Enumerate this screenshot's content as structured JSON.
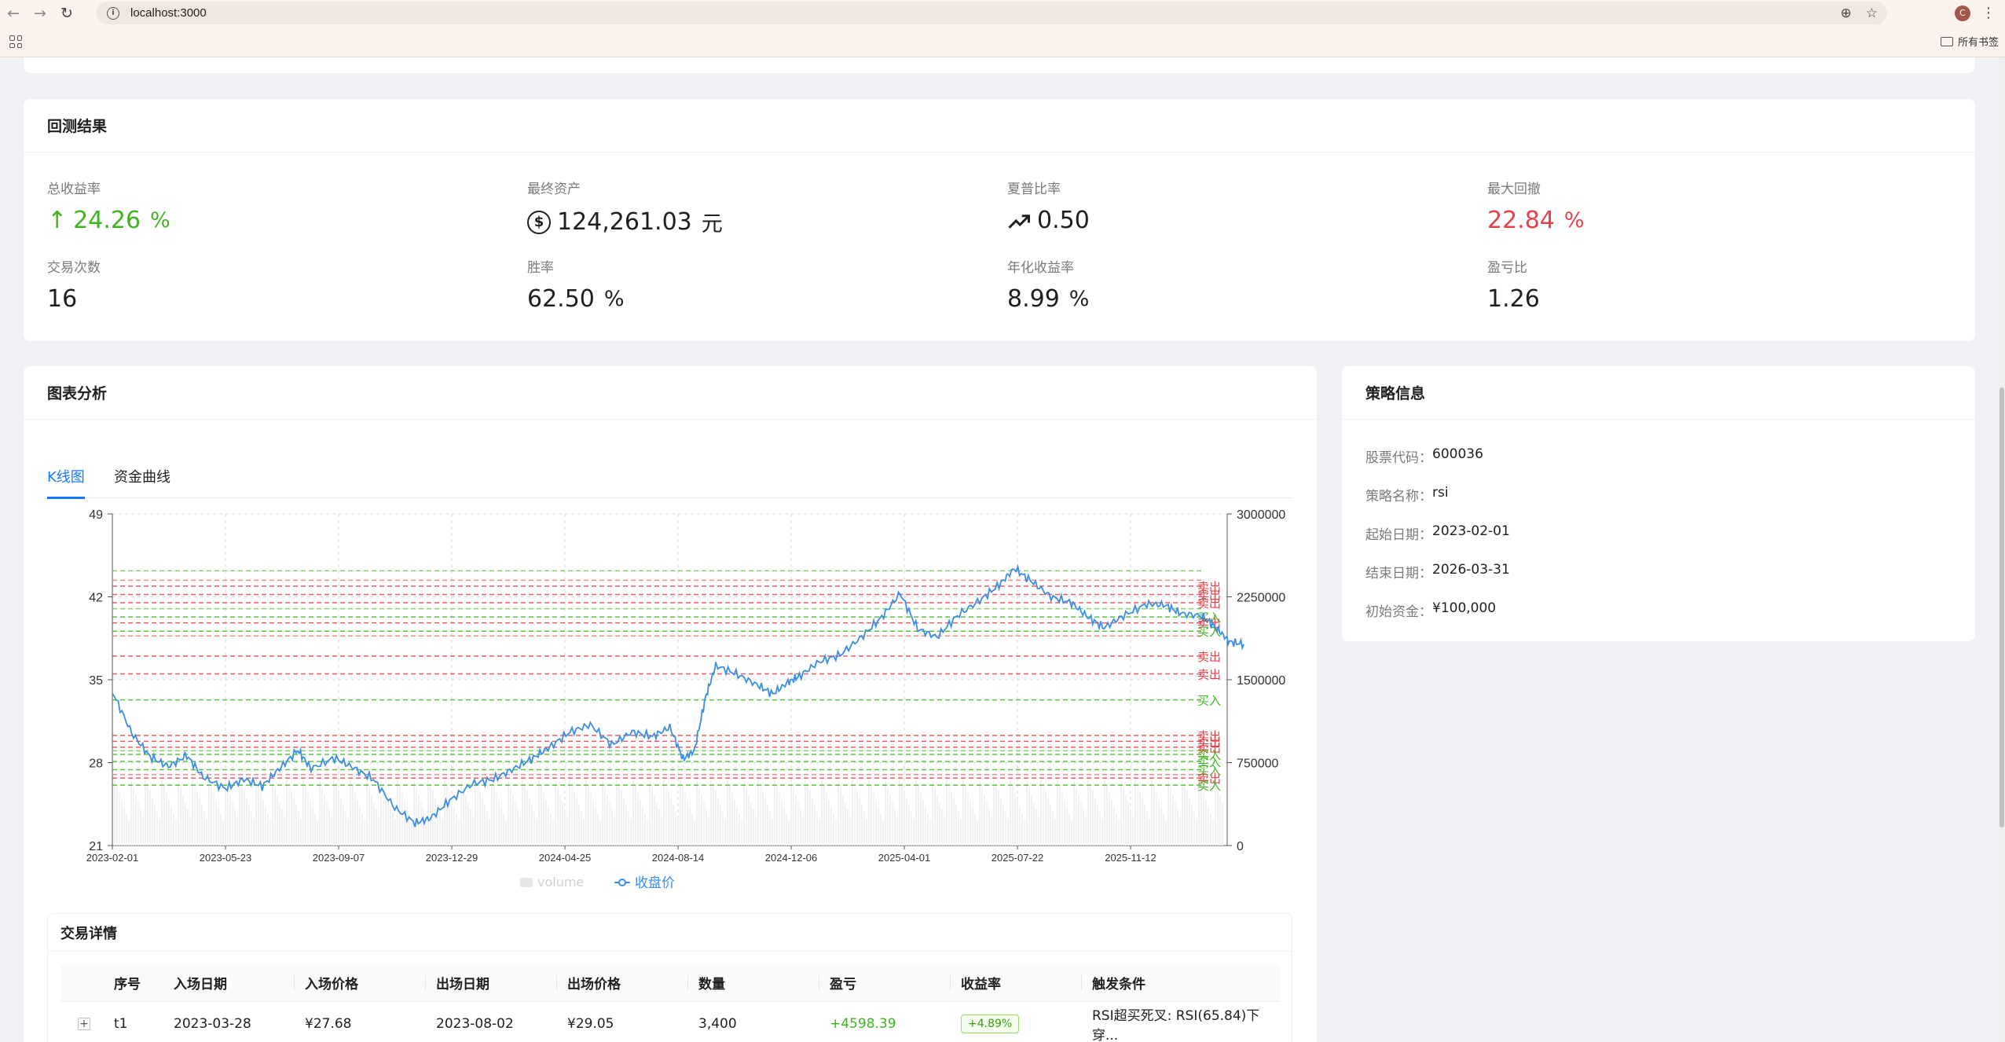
{
  "browser": {
    "url": "localhost:3000",
    "avatar_letter": "C",
    "bookmarks_all": "所有书签"
  },
  "results": {
    "title": "回测结果",
    "stats": [
      {
        "label": "总收益率",
        "value": "24.26",
        "unit": "%",
        "color": "#3fb520",
        "icon": "arrow-up-icon"
      },
      {
        "label": "最终资产",
        "value": "124,261.03",
        "unit": "元",
        "color": "#1f1f1f",
        "icon": "dollar-icon"
      },
      {
        "label": "夏普比率",
        "value": "0.50",
        "unit": "",
        "color": "#1f1f1f",
        "icon": "rise-icon"
      },
      {
        "label": "最大回撤",
        "value": "22.84",
        "unit": "%",
        "color": "#e8404a",
        "icon": ""
      },
      {
        "label": "交易次数",
        "value": "16",
        "unit": "",
        "color": "#1f1f1f",
        "icon": ""
      },
      {
        "label": "胜率",
        "value": "62.50",
        "unit": "%",
        "color": "#1f1f1f",
        "icon": ""
      },
      {
        "label": "年化收益率",
        "value": "8.99",
        "unit": "%",
        "color": "#1f1f1f",
        "icon": ""
      },
      {
        "label": "盈亏比",
        "value": "1.26",
        "unit": "",
        "color": "#1f1f1f",
        "icon": ""
      }
    ]
  },
  "chart_panel": {
    "title": "图表分析",
    "tabs": [
      {
        "label": "K线图",
        "active": true
      },
      {
        "label": "资金曲线",
        "active": false
      }
    ]
  },
  "chart_data": {
    "type": "line",
    "x_tick_labels": [
      "2023-02-01",
      "2023-05-23",
      "2023-09-07",
      "2023-12-29",
      "2024-04-25",
      "2024-08-14",
      "2024-12-06",
      "2025-04-01",
      "2025-07-22",
      "2025-11-12"
    ],
    "y_left_ticks": [
      21,
      28,
      35,
      42,
      49
    ],
    "y_right_ticks": [
      "0",
      "750000",
      "1500000",
      "2250000",
      "3000000"
    ],
    "ylim": [
      21,
      49
    ],
    "y2lim": [
      0,
      3000000
    ],
    "legend": [
      "volume",
      "收盘价"
    ],
    "legend_position": "bottom-center",
    "grid": true,
    "series": [
      {
        "name": "收盘价",
        "color": "#3a8ee6",
        "points": [
          [
            "2023-02-01",
            34.0
          ],
          [
            "2023-02-20",
            30.5
          ],
          [
            "2023-03-10",
            28.5
          ],
          [
            "2023-03-28",
            27.68
          ],
          [
            "2023-04-15",
            28.6
          ],
          [
            "2023-05-01",
            26.8
          ],
          [
            "2023-05-23",
            25.8
          ],
          [
            "2023-06-10",
            26.6
          ],
          [
            "2023-06-28",
            26.0
          ],
          [
            "2023-07-15",
            27.5
          ],
          [
            "2023-08-02",
            29.05
          ],
          [
            "2023-08-15",
            27.5
          ],
          [
            "2023-09-07",
            28.4
          ],
          [
            "2023-09-25",
            27.6
          ],
          [
            "2023-10-15",
            26.6
          ],
          [
            "2023-11-05",
            24.2
          ],
          [
            "2023-11-25",
            22.9
          ],
          [
            "2023-12-10",
            23.3
          ],
          [
            "2023-12-29",
            24.8
          ],
          [
            "2024-01-20",
            26.2
          ],
          [
            "2024-02-10",
            26.6
          ],
          [
            "2024-03-01",
            27.5
          ],
          [
            "2024-03-20",
            28.4
          ],
          [
            "2024-04-05",
            29.3
          ],
          [
            "2024-04-25",
            30.6
          ],
          [
            "2024-05-15",
            31.2
          ],
          [
            "2024-06-05",
            29.5
          ],
          [
            "2024-06-25",
            30.6
          ],
          [
            "2024-07-15",
            30.2
          ],
          [
            "2024-08-01",
            31.0
          ],
          [
            "2024-08-14",
            28.3
          ],
          [
            "2024-08-25",
            29.0
          ],
          [
            "2024-09-05",
            33.5
          ],
          [
            "2024-09-15",
            36.2
          ],
          [
            "2024-10-05",
            35.5
          ],
          [
            "2024-10-25",
            34.6
          ],
          [
            "2024-11-10",
            33.8
          ],
          [
            "2024-11-25",
            34.8
          ],
          [
            "2024-12-06",
            35.3
          ],
          [
            "2024-12-25",
            36.5
          ],
          [
            "2025-01-15",
            37.1
          ],
          [
            "2025-02-05",
            38.6
          ],
          [
            "2025-02-25",
            40.3
          ],
          [
            "2025-03-15",
            42.3
          ],
          [
            "2025-04-01",
            39.3
          ],
          [
            "2025-04-20",
            38.6
          ],
          [
            "2025-05-10",
            40.4
          ],
          [
            "2025-06-01",
            41.7
          ],
          [
            "2025-06-20",
            43.0
          ],
          [
            "2025-07-05",
            44.4
          ],
          [
            "2025-07-22",
            43.3
          ],
          [
            "2025-08-10",
            42.0
          ],
          [
            "2025-08-30",
            41.5
          ],
          [
            "2025-09-15",
            40.3
          ],
          [
            "2025-10-01",
            39.4
          ],
          [
            "2025-10-20",
            40.4
          ],
          [
            "2025-11-12",
            41.4
          ],
          [
            "2025-11-30",
            41.3
          ],
          [
            "2025-12-15",
            40.6
          ],
          [
            "2026-01-05",
            40.4
          ],
          [
            "2026-01-20",
            39.3
          ],
          [
            "2026-02-01",
            38.2
          ],
          [
            "2026-02-15",
            38.0
          ]
        ]
      }
    ],
    "trade_levels": [
      {
        "price": 42.9,
        "label": "卖出",
        "side": "sell"
      },
      {
        "price": 42.2,
        "label": "卖出",
        "side": "sell"
      },
      {
        "price": 41.5,
        "label": "卖出",
        "side": "sell"
      },
      {
        "price": 40.3,
        "label": "买入",
        "side": "buy"
      },
      {
        "price": 39.8,
        "label": "卖出",
        "side": "sell"
      },
      {
        "price": 39.1,
        "label": "买入",
        "side": "buy"
      },
      {
        "price": 37.0,
        "label": "卖出",
        "side": "sell"
      },
      {
        "price": 35.5,
        "label": "卖出",
        "side": "sell"
      },
      {
        "price": 33.3,
        "label": "买入",
        "side": "buy"
      },
      {
        "price": 30.3,
        "label": "卖出",
        "side": "sell"
      },
      {
        "price": 29.8,
        "label": "卖出",
        "side": "sell"
      },
      {
        "price": 29.3,
        "label": "卖出",
        "side": "sell"
      },
      {
        "price": 28.7,
        "label": "买入",
        "side": "buy"
      },
      {
        "price": 28.1,
        "label": "买入",
        "side": "buy"
      },
      {
        "price": 27.4,
        "label": "买入",
        "side": "buy"
      },
      {
        "price": 26.7,
        "label": "卖出",
        "side": "sell"
      },
      {
        "price": 26.1,
        "label": "买入",
        "side": "buy"
      }
    ],
    "extra_levels": [
      44.2,
      43.4,
      41.0,
      38.7,
      29.0,
      27.0
    ]
  },
  "trades": {
    "title": "交易详情",
    "columns": [
      "序号",
      "入场日期",
      "入场价格",
      "出场日期",
      "出场价格",
      "数量",
      "盈亏",
      "收益率",
      "触发条件"
    ],
    "rows": [
      {
        "expand": "+",
        "id": "t1",
        "entry_date": "2023-03-28",
        "entry_price": "¥27.68",
        "exit_date": "2023-08-02",
        "exit_price": "¥29.05",
        "qty": "3,400",
        "pnl": "+4598.39",
        "ret": "+4.89%",
        "trigger": "RSI超买死叉: RSI(65.84)下穿..."
      }
    ]
  },
  "strategy": {
    "title": "策略信息",
    "rows": [
      {
        "key": "股票代码：",
        "value": "600036"
      },
      {
        "key": "策略名称：",
        "value": "rsi"
      },
      {
        "key": "起始日期：",
        "value": "2023-02-01"
      },
      {
        "key": "结束日期：",
        "value": "2026-03-31"
      },
      {
        "key": "初始资金：",
        "value": "¥100,000"
      }
    ]
  },
  "colors": {
    "accent": "#1677ff",
    "buy": "#3fb520",
    "sell": "#e8404a"
  }
}
